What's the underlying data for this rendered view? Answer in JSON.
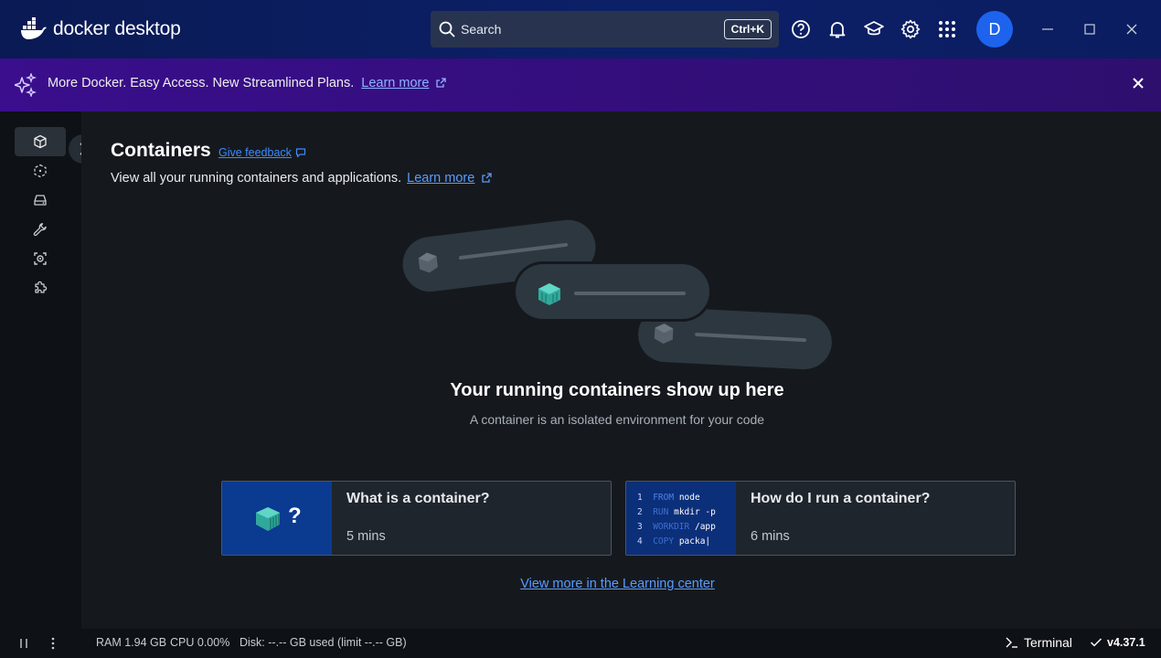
{
  "app": {
    "logo_text": "docker desktop"
  },
  "search": {
    "label": "Search",
    "shortcut": "Ctrl+K"
  },
  "titlebar": {
    "avatar_initial": "D"
  },
  "banner": {
    "text": "More Docker. Easy Access. New Streamlined Plans.",
    "link": "Learn more"
  },
  "sidebar": {
    "items": [
      {
        "name": "containers",
        "icon": "container-cube-icon",
        "active": true
      },
      {
        "name": "images",
        "icon": "images-icon"
      },
      {
        "name": "volumes",
        "icon": "volumes-icon"
      },
      {
        "name": "builds",
        "icon": "wrench-icon"
      },
      {
        "name": "docker-scout",
        "icon": "scout-icon"
      },
      {
        "name": "extensions",
        "icon": "puzzle-icon"
      }
    ]
  },
  "page": {
    "title": "Containers",
    "feedback": "Give feedback",
    "subtitle": "View all your running containers and applications.",
    "subtitle_link": "Learn more"
  },
  "empty_state": {
    "title": "Your running containers show up here",
    "subtitle": "A container is an isolated environment for your code"
  },
  "cards": [
    {
      "title": "What is a container?",
      "duration": "5 mins",
      "thumb_glyph": "?"
    },
    {
      "title": "How do I run a container?",
      "duration": "6 mins",
      "code": [
        {
          "n": "1",
          "kw": "FROM",
          "arg": "node"
        },
        {
          "n": "2",
          "kw": "RUN",
          "arg": "mkdir -p"
        },
        {
          "n": "3",
          "kw": "WORKDIR",
          "arg": "/app"
        },
        {
          "n": "4",
          "kw": "COPY",
          "arg": "packa"
        }
      ]
    }
  ],
  "learning_center_link": "View more in the Learning center",
  "footer": {
    "ram": "RAM 1.94 GB",
    "cpu": "CPU 0.00%",
    "disk": "Disk: --.-- GB used (limit --.-- GB)",
    "terminal": "Terminal",
    "version": "v4.37.1"
  },
  "colors": {
    "accent": "#1d63ed",
    "banner": "#3a0e8c",
    "link": "#5a9bff",
    "teal": "#3ec1b4"
  }
}
